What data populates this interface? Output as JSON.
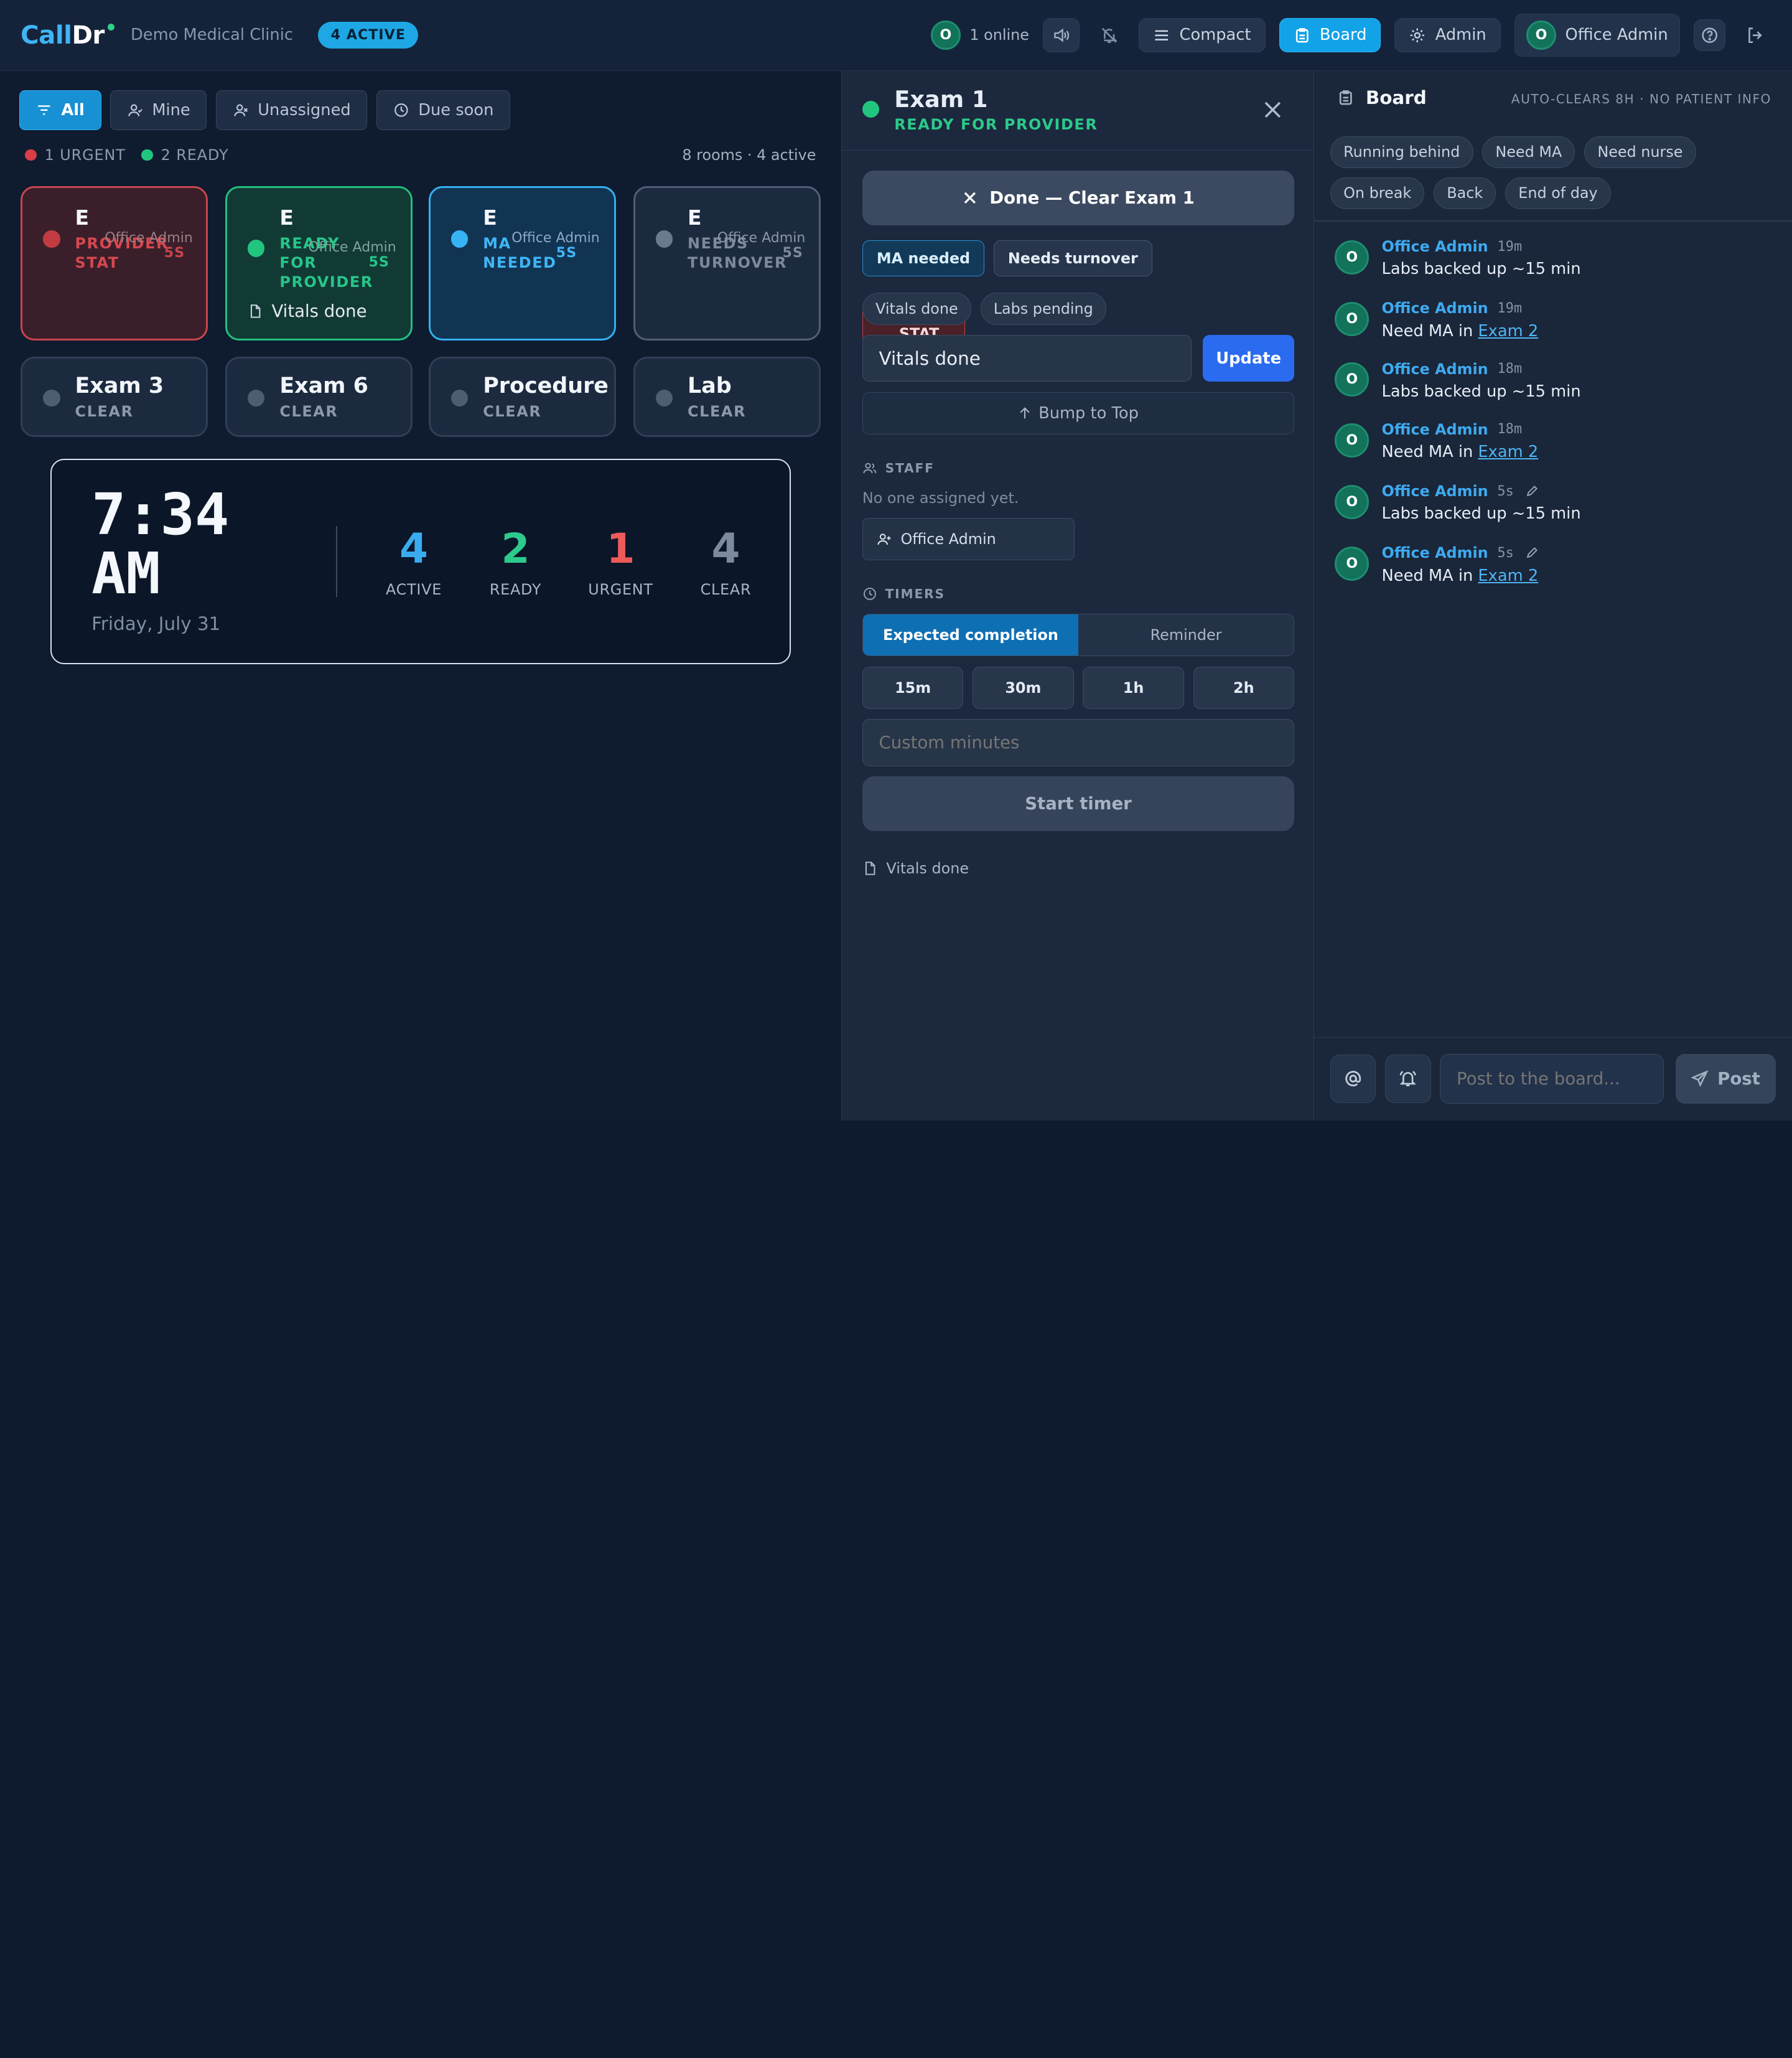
{
  "header": {
    "logo_call": "Call",
    "logo_dr": "Dr",
    "clinic": "Demo Medical Clinic",
    "active_badge": "4 ACTIVE",
    "online_avatar": "O",
    "online_text": "1 online",
    "compact_label": "Compact",
    "board_label": "Board",
    "admin_label": "Admin",
    "user_avatar": "O",
    "user_name": "Office Admin"
  },
  "filters": {
    "all": "All",
    "mine": "Mine",
    "unassigned": "Unassigned",
    "due_soon": "Due soon"
  },
  "counts": {
    "urgent": "1 URGENT",
    "ready": "2 READY",
    "summary": "8 rooms · 4 active"
  },
  "rooms": {
    "r1": {
      "name": "E",
      "status_1": "PROVIDER",
      "status_2": "STAT",
      "who": "Office Admin",
      "time": "5S"
    },
    "r2": {
      "name": "E",
      "status_1": "READY",
      "status_2": "FOR",
      "status_3": "PROVIDER",
      "who": "Office Admin",
      "time": "5S",
      "note": "Vitals done"
    },
    "r3": {
      "name": "E",
      "status_1": "MA",
      "status_2": "NEEDED",
      "who": "Office Admin",
      "time": "5S"
    },
    "r4": {
      "name": "E",
      "status_1": "NEEDS",
      "status_2": "TURNOVER",
      "who": "Office Admin",
      "time": "5S"
    },
    "r5": {
      "name": "Exam 3",
      "status": "CLEAR"
    },
    "r6": {
      "name": "Exam 6",
      "status": "CLEAR"
    },
    "r7": {
      "name": "Procedure",
      "status": "CLEAR"
    },
    "r8": {
      "name": "Lab",
      "status": "CLEAR"
    }
  },
  "clock": {
    "time_line1": "7:34",
    "time_line2": "AM",
    "date": "Friday, July 31",
    "stats": [
      {
        "num": "4",
        "label": "ACTIVE",
        "color": "#3aabef"
      },
      {
        "num": "2",
        "label": "READY",
        "color": "#2ec98d"
      },
      {
        "num": "1",
        "label": "URGENT",
        "color": "#ee5a5a"
      },
      {
        "num": "4",
        "label": "CLEAR",
        "color": "#7c8aa0"
      }
    ]
  },
  "detail": {
    "title": "Exam 1",
    "status": "READY FOR PROVIDER",
    "done_button": "Done — Clear Exam 1",
    "tags": {
      "ma": "MA needed",
      "stat": "Provider STAT",
      "turnover": "Needs turnover"
    },
    "chips": {
      "vitals": "Vitals done",
      "labs": "Labs pending"
    },
    "note_value": "Vitals done",
    "update_button": "Update",
    "bump_button": "Bump to Top",
    "staff_label": "STAFF",
    "staff_empty": "No one assigned yet.",
    "assign_button": "Office Admin",
    "timers_label": "TIMERS",
    "timer_modes": {
      "expected": "Expected completion",
      "reminder": "Reminder"
    },
    "durations": [
      "15m",
      "30m",
      "1h",
      "2h"
    ],
    "custom_placeholder": "Custom minutes",
    "start_button": "Start timer",
    "footer_note": "Vitals done"
  },
  "board": {
    "title": "Board",
    "meta": "AUTO-CLEARS 8H · NO PATIENT INFO",
    "chips": [
      "Running behind",
      "Need MA",
      "Need nurse",
      "On break",
      "Back",
      "End of day"
    ],
    "messages": [
      {
        "avatar": "O",
        "author": "Office Admin",
        "when": "19m",
        "text": "Labs backed up ~15 min"
      },
      {
        "avatar": "O",
        "author": "Office Admin",
        "when": "19m",
        "text_pre": "Need MA in ",
        "link": "Exam 2"
      },
      {
        "avatar": "O",
        "author": "Office Admin",
        "when": "18m",
        "text": "Labs backed up ~15 min"
      },
      {
        "avatar": "O",
        "author": "Office Admin",
        "when": "18m",
        "text_pre": "Need MA in ",
        "link": "Exam 2"
      },
      {
        "avatar": "O",
        "author": "Office Admin",
        "when": "5s",
        "text": "Labs backed up ~15 min"
      },
      {
        "avatar": "O",
        "author": "Office Admin",
        "when": "5s",
        "text_pre": "Need MA in ",
        "link": "Exam 2"
      }
    ],
    "composer_placeholder": "Post to the board...",
    "post_button": "Post"
  },
  "colors": {
    "accent": "#12a2e8",
    "urgent": "#e04848",
    "ready": "#22c57e",
    "ma": "#35b3f5",
    "neutral": "#7b889b"
  }
}
